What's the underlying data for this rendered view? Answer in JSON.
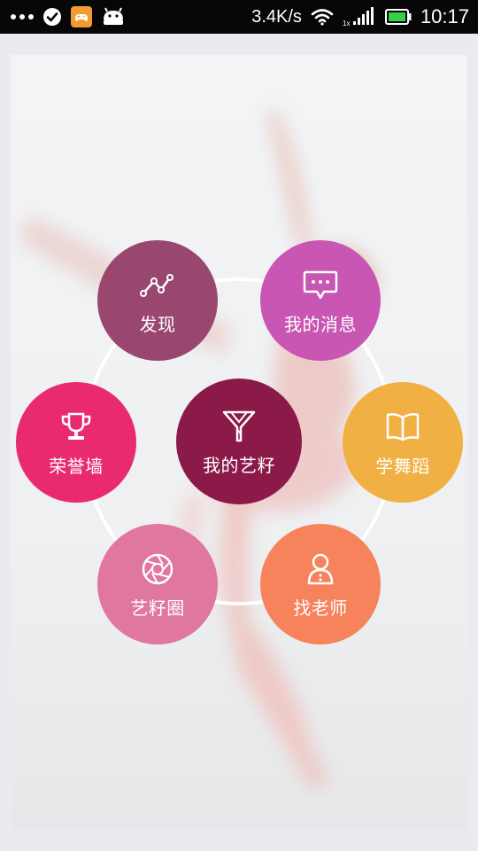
{
  "status_bar": {
    "network_speed": "3.4K/s",
    "time": "10:17",
    "left_icons": [
      "more-dots-icon",
      "check-circle-icon",
      "game-controller-app-icon",
      "android-robot-icon"
    ],
    "right_icons": [
      "wifi-icon",
      "signal-icon",
      "battery-icon"
    ],
    "battery_color": "#35d04a"
  },
  "menu": {
    "center": {
      "label": "我的艺籽",
      "icon": "y-logo-icon",
      "color": "#8b1a48"
    },
    "items": [
      {
        "label": "发现",
        "icon": "line-graph-icon",
        "color": "#9a4770"
      },
      {
        "label": "我的消息",
        "icon": "message-bubble-icon",
        "color": "#c956b3"
      },
      {
        "label": "荣誉墙",
        "icon": "trophy-icon",
        "color": "#e92a6e"
      },
      {
        "label": "学舞蹈",
        "icon": "open-book-icon",
        "color": "#f0b043"
      },
      {
        "label": "艺籽圈",
        "icon": "camera-aperture-icon",
        "color": "#e0779f"
      },
      {
        "label": "找老师",
        "icon": "teacher-person-icon",
        "color": "#f6835c"
      }
    ]
  }
}
